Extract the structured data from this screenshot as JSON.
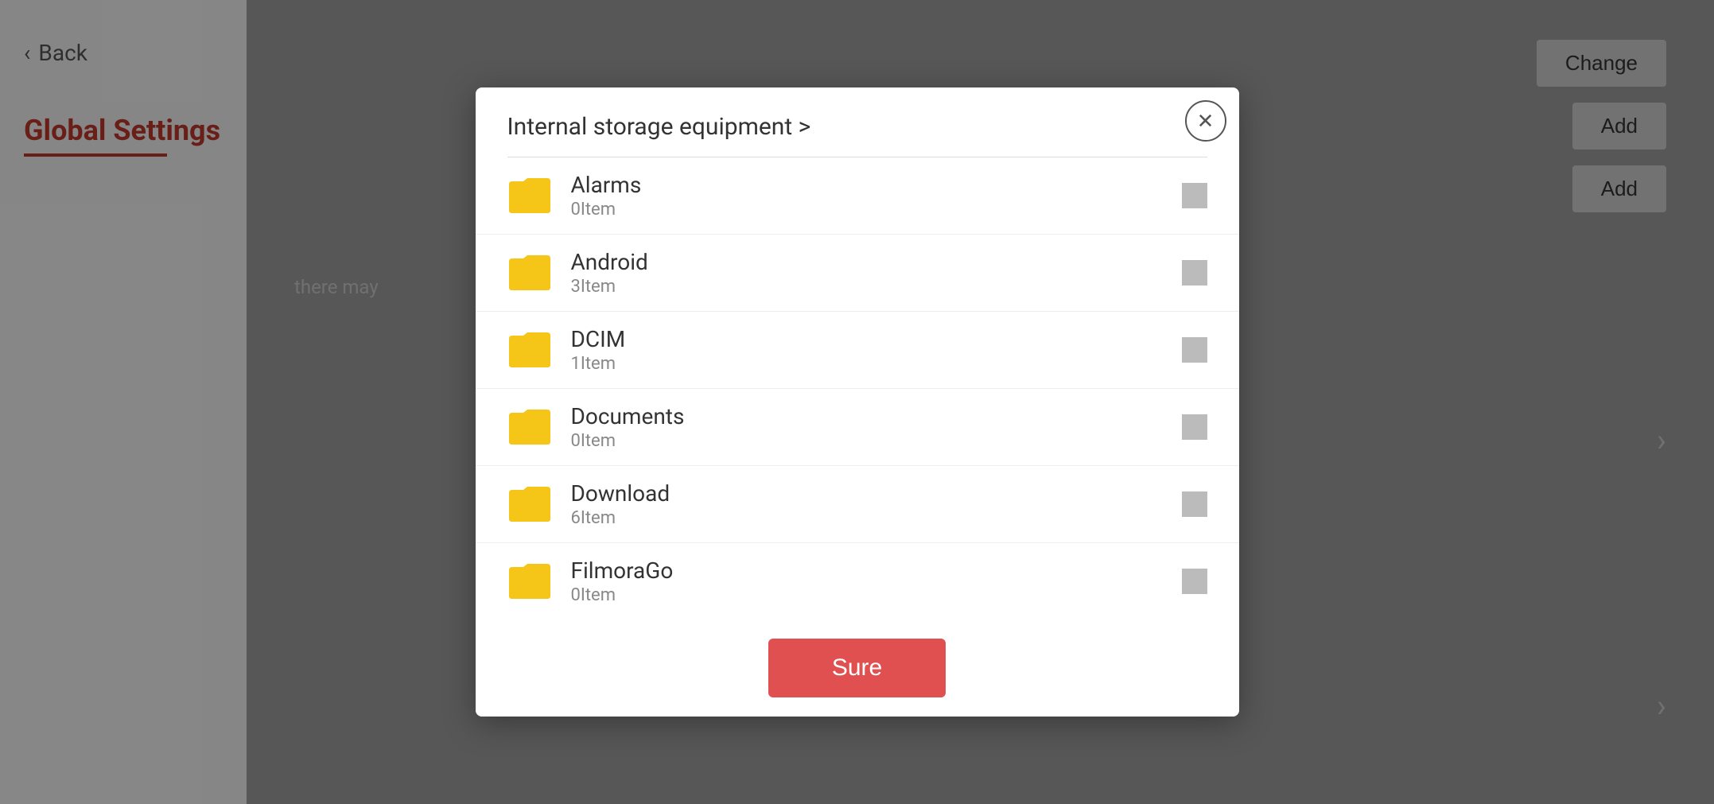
{
  "background": {
    "back_label": "Back",
    "sidebar_title": "Global Settings",
    "buttons": [
      {
        "label": "Change"
      },
      {
        "label": "Add"
      },
      {
        "label": "Add"
      }
    ],
    "side_text": "there may",
    "right_arrow": "›"
  },
  "modal": {
    "title": "Internal storage equipment >",
    "close_symbol": "✕",
    "folders": [
      {
        "name": "Alarms",
        "count": "0Item"
      },
      {
        "name": "Android",
        "count": "3Item"
      },
      {
        "name": "DCIM",
        "count": "1Item"
      },
      {
        "name": "Documents",
        "count": "0Item"
      },
      {
        "name": "Download",
        "count": "6Item"
      },
      {
        "name": "FilmoraGo",
        "count": "0Item"
      }
    ],
    "sure_label": "Sure"
  }
}
